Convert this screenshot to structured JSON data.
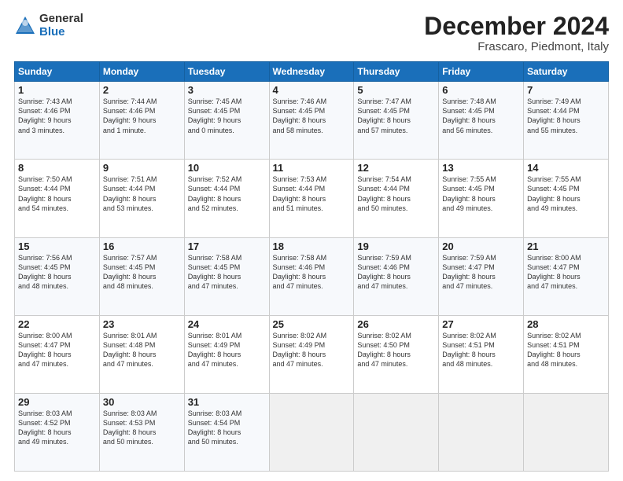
{
  "header": {
    "logo_general": "General",
    "logo_blue": "Blue",
    "month_title": "December 2024",
    "location": "Frascaro, Piedmont, Italy"
  },
  "days_of_week": [
    "Sunday",
    "Monday",
    "Tuesday",
    "Wednesday",
    "Thursday",
    "Friday",
    "Saturday"
  ],
  "weeks": [
    [
      {
        "day": "1",
        "lines": [
          "Sunrise: 7:43 AM",
          "Sunset: 4:46 PM",
          "Daylight: 9 hours",
          "and 3 minutes."
        ]
      },
      {
        "day": "2",
        "lines": [
          "Sunrise: 7:44 AM",
          "Sunset: 4:46 PM",
          "Daylight: 9 hours",
          "and 1 minute."
        ]
      },
      {
        "day": "3",
        "lines": [
          "Sunrise: 7:45 AM",
          "Sunset: 4:45 PM",
          "Daylight: 9 hours",
          "and 0 minutes."
        ]
      },
      {
        "day": "4",
        "lines": [
          "Sunrise: 7:46 AM",
          "Sunset: 4:45 PM",
          "Daylight: 8 hours",
          "and 58 minutes."
        ]
      },
      {
        "day": "5",
        "lines": [
          "Sunrise: 7:47 AM",
          "Sunset: 4:45 PM",
          "Daylight: 8 hours",
          "and 57 minutes."
        ]
      },
      {
        "day": "6",
        "lines": [
          "Sunrise: 7:48 AM",
          "Sunset: 4:45 PM",
          "Daylight: 8 hours",
          "and 56 minutes."
        ]
      },
      {
        "day": "7",
        "lines": [
          "Sunrise: 7:49 AM",
          "Sunset: 4:44 PM",
          "Daylight: 8 hours",
          "and 55 minutes."
        ]
      }
    ],
    [
      {
        "day": "8",
        "lines": [
          "Sunrise: 7:50 AM",
          "Sunset: 4:44 PM",
          "Daylight: 8 hours",
          "and 54 minutes."
        ]
      },
      {
        "day": "9",
        "lines": [
          "Sunrise: 7:51 AM",
          "Sunset: 4:44 PM",
          "Daylight: 8 hours",
          "and 53 minutes."
        ]
      },
      {
        "day": "10",
        "lines": [
          "Sunrise: 7:52 AM",
          "Sunset: 4:44 PM",
          "Daylight: 8 hours",
          "and 52 minutes."
        ]
      },
      {
        "day": "11",
        "lines": [
          "Sunrise: 7:53 AM",
          "Sunset: 4:44 PM",
          "Daylight: 8 hours",
          "and 51 minutes."
        ]
      },
      {
        "day": "12",
        "lines": [
          "Sunrise: 7:54 AM",
          "Sunset: 4:44 PM",
          "Daylight: 8 hours",
          "and 50 minutes."
        ]
      },
      {
        "day": "13",
        "lines": [
          "Sunrise: 7:55 AM",
          "Sunset: 4:45 PM",
          "Daylight: 8 hours",
          "and 49 minutes."
        ]
      },
      {
        "day": "14",
        "lines": [
          "Sunrise: 7:55 AM",
          "Sunset: 4:45 PM",
          "Daylight: 8 hours",
          "and 49 minutes."
        ]
      }
    ],
    [
      {
        "day": "15",
        "lines": [
          "Sunrise: 7:56 AM",
          "Sunset: 4:45 PM",
          "Daylight: 8 hours",
          "and 48 minutes."
        ]
      },
      {
        "day": "16",
        "lines": [
          "Sunrise: 7:57 AM",
          "Sunset: 4:45 PM",
          "Daylight: 8 hours",
          "and 48 minutes."
        ]
      },
      {
        "day": "17",
        "lines": [
          "Sunrise: 7:58 AM",
          "Sunset: 4:45 PM",
          "Daylight: 8 hours",
          "and 47 minutes."
        ]
      },
      {
        "day": "18",
        "lines": [
          "Sunrise: 7:58 AM",
          "Sunset: 4:46 PM",
          "Daylight: 8 hours",
          "and 47 minutes."
        ]
      },
      {
        "day": "19",
        "lines": [
          "Sunrise: 7:59 AM",
          "Sunset: 4:46 PM",
          "Daylight: 8 hours",
          "and 47 minutes."
        ]
      },
      {
        "day": "20",
        "lines": [
          "Sunrise: 7:59 AM",
          "Sunset: 4:47 PM",
          "Daylight: 8 hours",
          "and 47 minutes."
        ]
      },
      {
        "day": "21",
        "lines": [
          "Sunrise: 8:00 AM",
          "Sunset: 4:47 PM",
          "Daylight: 8 hours",
          "and 47 minutes."
        ]
      }
    ],
    [
      {
        "day": "22",
        "lines": [
          "Sunrise: 8:00 AM",
          "Sunset: 4:47 PM",
          "Daylight: 8 hours",
          "and 47 minutes."
        ]
      },
      {
        "day": "23",
        "lines": [
          "Sunrise: 8:01 AM",
          "Sunset: 4:48 PM",
          "Daylight: 8 hours",
          "and 47 minutes."
        ]
      },
      {
        "day": "24",
        "lines": [
          "Sunrise: 8:01 AM",
          "Sunset: 4:49 PM",
          "Daylight: 8 hours",
          "and 47 minutes."
        ]
      },
      {
        "day": "25",
        "lines": [
          "Sunrise: 8:02 AM",
          "Sunset: 4:49 PM",
          "Daylight: 8 hours",
          "and 47 minutes."
        ]
      },
      {
        "day": "26",
        "lines": [
          "Sunrise: 8:02 AM",
          "Sunset: 4:50 PM",
          "Daylight: 8 hours",
          "and 47 minutes."
        ]
      },
      {
        "day": "27",
        "lines": [
          "Sunrise: 8:02 AM",
          "Sunset: 4:51 PM",
          "Daylight: 8 hours",
          "and 48 minutes."
        ]
      },
      {
        "day": "28",
        "lines": [
          "Sunrise: 8:02 AM",
          "Sunset: 4:51 PM",
          "Daylight: 8 hours",
          "and 48 minutes."
        ]
      }
    ],
    [
      {
        "day": "29",
        "lines": [
          "Sunrise: 8:03 AM",
          "Sunset: 4:52 PM",
          "Daylight: 8 hours",
          "and 49 minutes."
        ]
      },
      {
        "day": "30",
        "lines": [
          "Sunrise: 8:03 AM",
          "Sunset: 4:53 PM",
          "Daylight: 8 hours",
          "and 50 minutes."
        ]
      },
      {
        "day": "31",
        "lines": [
          "Sunrise: 8:03 AM",
          "Sunset: 4:54 PM",
          "Daylight: 8 hours",
          "and 50 minutes."
        ]
      },
      null,
      null,
      null,
      null
    ]
  ]
}
